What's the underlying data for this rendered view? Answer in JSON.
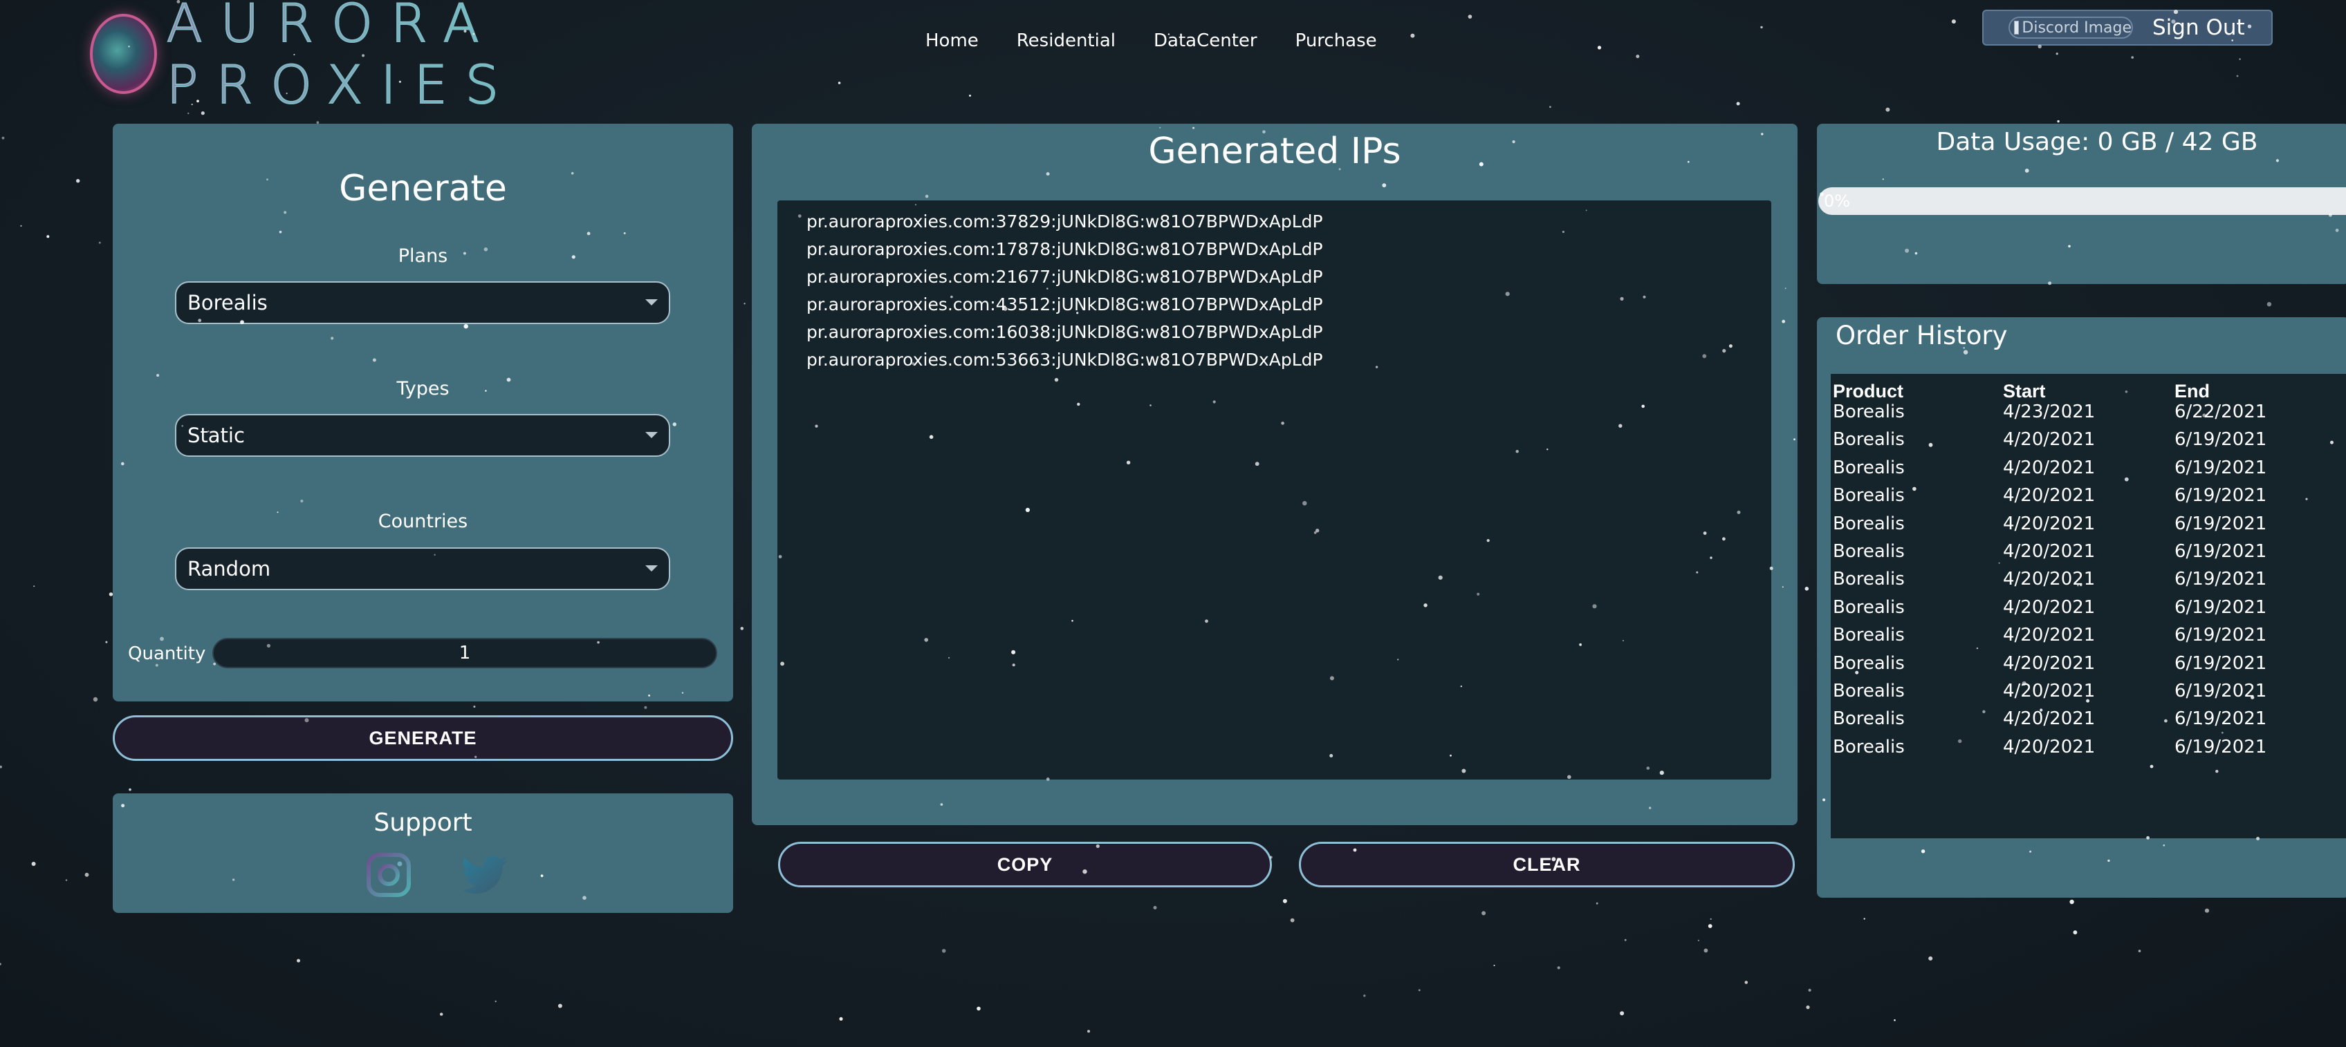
{
  "brand": {
    "name": "AURORA PROXIES"
  },
  "nav": [
    "Home",
    "Residential",
    "DataCenter",
    "Purchase"
  ],
  "account": {
    "discord_image_alt": "Discord Image",
    "signout_label": "Sign Out"
  },
  "generate": {
    "title": "Generate",
    "plans_label": "Plans",
    "plans_value": "Borealis",
    "types_label": "Types",
    "types_value": "Static",
    "countries_label": "Countries",
    "countries_value": "Random",
    "quantity_label": "Quantity",
    "quantity_value": "1",
    "button_label": "GENERATE"
  },
  "support": {
    "title": "Support",
    "icons": [
      "instagram-icon",
      "twitter-icon"
    ]
  },
  "generated": {
    "title": "Generated IPs",
    "ips": [
      "pr.auroraproxies.com:37829:jUNkDl8G:w81O7BPWDxApLdP",
      "pr.auroraproxies.com:17878:jUNkDl8G:w81O7BPWDxApLdP",
      "pr.auroraproxies.com:21677:jUNkDl8G:w81O7BPWDxApLdP",
      "pr.auroraproxies.com:43512:jUNkDl8G:w81O7BPWDxApLdP",
      "pr.auroraproxies.com:16038:jUNkDl8G:w81O7BPWDxApLdP",
      "pr.auroraproxies.com:53663:jUNkDl8G:w81O7BPWDxApLdP"
    ],
    "copy_label": "COPY",
    "clear_label": "CLEAR"
  },
  "usage": {
    "label": "Data Usage: 0 GB / 42 GB",
    "percent": 0,
    "percent_label": "0%"
  },
  "orders": {
    "title": "Order History",
    "columns": [
      "Product",
      "Start",
      "End"
    ],
    "rows": [
      [
        "Borealis",
        "4/23/2021",
        "6/22/2021"
      ],
      [
        "Borealis",
        "4/20/2021",
        "6/19/2021"
      ],
      [
        "Borealis",
        "4/20/2021",
        "6/19/2021"
      ],
      [
        "Borealis",
        "4/20/2021",
        "6/19/2021"
      ],
      [
        "Borealis",
        "4/20/2021",
        "6/19/2021"
      ],
      [
        "Borealis",
        "4/20/2021",
        "6/19/2021"
      ],
      [
        "Borealis",
        "4/20/2021",
        "6/19/2021"
      ],
      [
        "Borealis",
        "4/20/2021",
        "6/19/2021"
      ],
      [
        "Borealis",
        "4/20/2021",
        "6/19/2021"
      ],
      [
        "Borealis",
        "4/20/2021",
        "6/19/2021"
      ],
      [
        "Borealis",
        "4/20/2021",
        "6/19/2021"
      ],
      [
        "Borealis",
        "4/20/2021",
        "6/19/2021"
      ],
      [
        "Borealis",
        "4/20/2021",
        "6/19/2021"
      ]
    ]
  },
  "colors": {
    "background": "#141d24",
    "panel": "#426e7c",
    "field": "#15222a",
    "button": "#211d2f",
    "button_border": "#8fbfd6"
  }
}
